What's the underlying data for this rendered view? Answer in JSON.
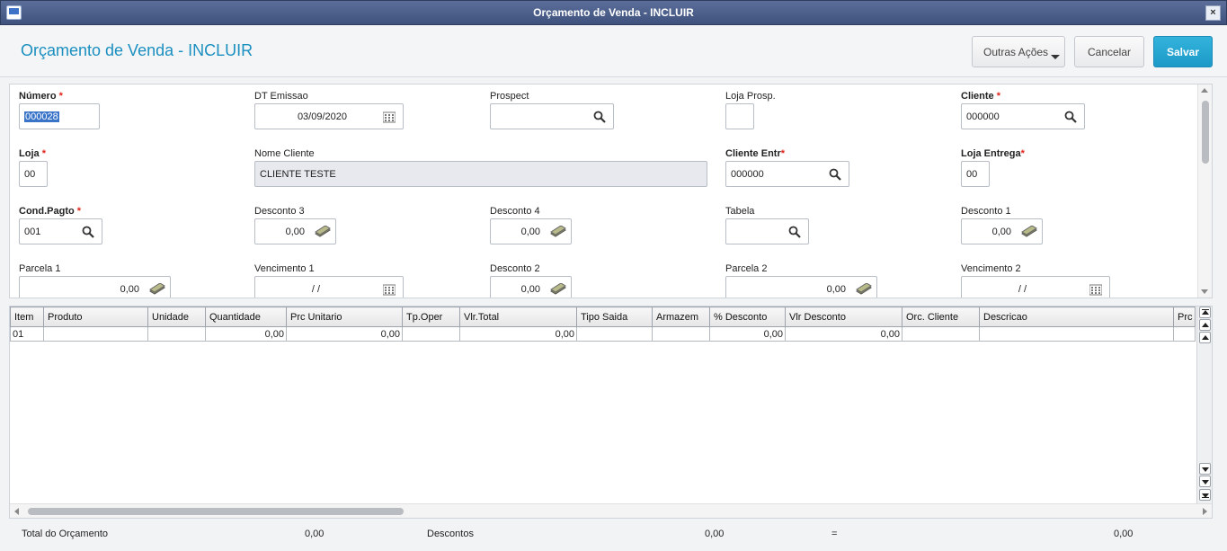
{
  "window": {
    "title": "Orçamento de Venda - INCLUIR",
    "close_label": "×"
  },
  "header": {
    "page_title": "Orçamento de Venda - INCLUIR",
    "buttons": {
      "outras": "Outras Ações",
      "cancelar": "Cancelar",
      "salvar": "Salvar"
    }
  },
  "form": {
    "numero": {
      "label": "Número",
      "value": "000028"
    },
    "dt_emissao": {
      "label": "DT Emissao",
      "value": "03/09/2020"
    },
    "prospect": {
      "label": "Prospect",
      "value": ""
    },
    "loja_prosp": {
      "label": "Loja Prosp.",
      "value": ""
    },
    "cliente": {
      "label": "Cliente",
      "value": "000000"
    },
    "loja": {
      "label": "Loja",
      "value": "00"
    },
    "nome_cliente": {
      "label": "Nome Cliente",
      "value": "CLIENTE TESTE"
    },
    "cliente_entr": {
      "label": "Cliente Entr",
      "value": "000000"
    },
    "loja_entrega": {
      "label": "Loja Entrega",
      "value": "00"
    },
    "cond_pagto": {
      "label": "Cond.Pagto",
      "value": "001"
    },
    "desconto3": {
      "label": "Desconto 3",
      "value": "0,00"
    },
    "desconto4": {
      "label": "Desconto 4",
      "value": "0,00"
    },
    "tabela": {
      "label": "Tabela",
      "value": ""
    },
    "desconto1": {
      "label": "Desconto 1",
      "value": "0,00"
    },
    "parcela1": {
      "label": "Parcela 1",
      "value": "0,00"
    },
    "vencimento1": {
      "label": "Vencimento 1",
      "value": "/ /"
    },
    "desconto2": {
      "label": "Desconto 2",
      "value": "0,00"
    },
    "parcela2": {
      "label": "Parcela 2",
      "value": "0,00"
    },
    "vencimento2": {
      "label": "Vencimento 2",
      "value": "/ /"
    },
    "required_mark": "*"
  },
  "grid": {
    "columns": [
      "Item",
      "Produto",
      "Unidade",
      "Quantidade",
      "Prc Unitario",
      "Tp.Oper",
      "Vlr.Total",
      "Tipo Saida",
      "Armazem",
      "% Desconto",
      "Vlr Desconto",
      "Orc. Cliente",
      "Descricao",
      "Prc"
    ],
    "rows": [
      [
        "01",
        "",
        "",
        "0,00",
        "0,00",
        "",
        "0,00",
        "",
        "",
        "0,00",
        "0,00",
        "",
        "",
        ""
      ]
    ]
  },
  "footer": {
    "total_label": "Total do Orçamento",
    "total_value": "0,00",
    "descontos_label": "Descontos",
    "descontos_value": "0,00",
    "equals": "=",
    "final_value": "0,00"
  },
  "colors": {
    "accent": "#1b8fc0",
    "salvar": "#1d9ac8",
    "titlebar": "#3f527e"
  }
}
